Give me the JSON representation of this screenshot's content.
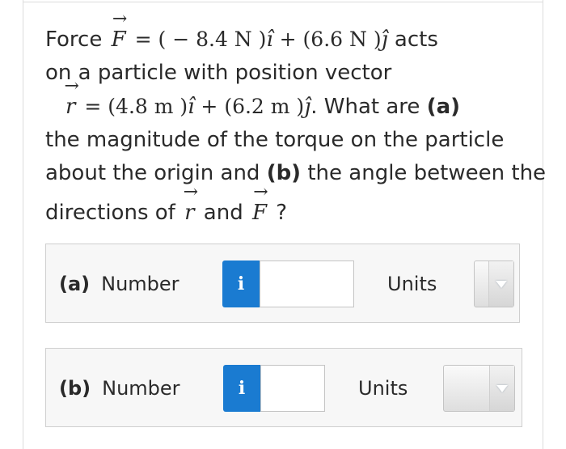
{
  "question": {
    "l1_pre": "Force ",
    "force_symbol": "F",
    "l1_eq": " = ( − 8.4 N )",
    "i_hat": "î",
    "l1_plus": " + (6.6 N )",
    "j_hat": "ĵ",
    "l1_post": " acts",
    "line2": "on a particle with position vector",
    "pos_symbol": "r",
    "l3_eq": " = (4.8 m )",
    "l3_plus": " + (6.2 m )",
    "l3_post": ". What are ",
    "part_a": "(a)",
    "line4": "the magnitude of the torque on the particle",
    "l5_pre": "about the origin and ",
    "part_b": "(b)",
    "l5_post": " the angle between the",
    "l6_pre": "directions of ",
    "l6_and": " and ",
    "l6_q": " ?",
    "arrow_glyph": "→"
  },
  "answers": [
    {
      "part": "(a)",
      "label": "Number",
      "info_glyph": "i",
      "value": "",
      "units_label": "Units",
      "units_value": ""
    },
    {
      "part": "(b)",
      "label": "Number",
      "info_glyph": "i",
      "value": "",
      "units_label": "Units",
      "units_value": ""
    }
  ],
  "colors": {
    "info_button": "#1a7bd1",
    "panel_bg": "#f7f7f7",
    "text": "#2a2a2a"
  }
}
